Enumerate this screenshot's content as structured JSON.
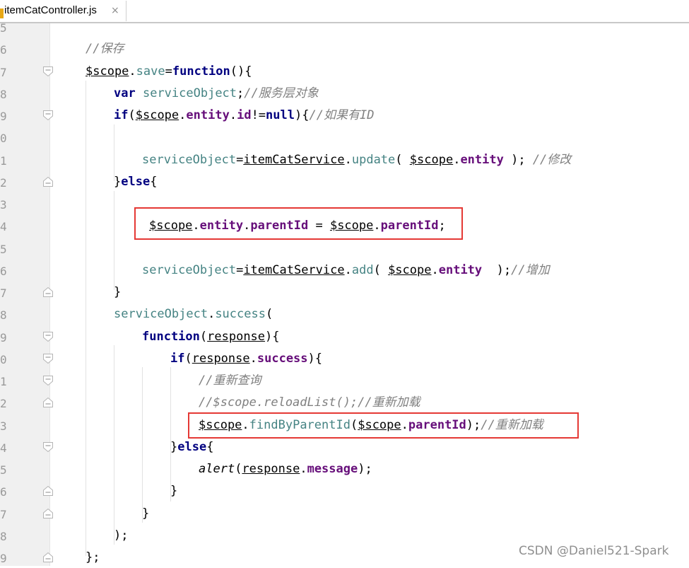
{
  "tab": {
    "label": "itemCatController.js",
    "close": "×"
  },
  "line_numbers": [
    "5",
    "6",
    "7",
    "8",
    "9",
    "0",
    "1",
    "2",
    "3",
    "4",
    "5",
    "6",
    "7",
    "8",
    "9",
    "0",
    "1",
    "2",
    "3",
    "4",
    "5",
    "6",
    "7",
    "8",
    "9"
  ],
  "code": [
    [],
    [
      [
        "cm",
        "//保存"
      ]
    ],
    [
      [
        "sc",
        "$scope"
      ],
      [
        "pu",
        "."
      ],
      [
        "var",
        "save"
      ],
      [
        "pu",
        "="
      ],
      [
        "kw",
        "function"
      ],
      [
        "pu",
        "(){"
      ]
    ],
    [
      [
        "kw",
        "var"
      ],
      [
        "pu",
        " "
      ],
      [
        "var",
        "serviceObject"
      ],
      [
        "pu",
        ";"
      ],
      [
        "cm",
        "//服务层对象"
      ]
    ],
    [
      [
        "kw",
        "if"
      ],
      [
        "pu",
        "("
      ],
      [
        "sc",
        "$scope"
      ],
      [
        "pu",
        "."
      ],
      [
        "pr",
        "entity"
      ],
      [
        "pu",
        "."
      ],
      [
        "pr",
        "id"
      ],
      [
        "pu",
        "!="
      ],
      [
        "kw",
        "null"
      ],
      [
        "pu",
        ")"
      ],
      [
        "pu",
        "{"
      ],
      [
        "cm",
        "//如果有ID"
      ]
    ],
    [],
    [
      [
        "var",
        "serviceObject"
      ],
      [
        "pu",
        "="
      ],
      [
        "sc",
        "itemCatService"
      ],
      [
        "pu",
        "."
      ],
      [
        "var",
        "update"
      ],
      [
        "pu",
        "( "
      ],
      [
        "sc",
        "$scope"
      ],
      [
        "pu",
        "."
      ],
      [
        "pr",
        "entity"
      ],
      [
        "pu",
        " ); "
      ],
      [
        "cm",
        "//修改"
      ]
    ],
    [
      [
        "pu",
        "}"
      ],
      [
        "kw",
        "else"
      ],
      [
        "pu",
        "{"
      ]
    ],
    [],
    [
      [
        "sc",
        "$scope"
      ],
      [
        "pu",
        "."
      ],
      [
        "pr",
        "entity"
      ],
      [
        "pu",
        "."
      ],
      [
        "pr",
        "parentId"
      ],
      [
        "pu",
        " = "
      ],
      [
        "sc",
        "$scope"
      ],
      [
        "pu",
        "."
      ],
      [
        "pr",
        "parentId"
      ],
      [
        "pu",
        ";"
      ]
    ],
    [],
    [
      [
        "var",
        "serviceObject"
      ],
      [
        "pu",
        "="
      ],
      [
        "sc",
        "itemCatService"
      ],
      [
        "pu",
        "."
      ],
      [
        "var",
        "add"
      ],
      [
        "pu",
        "( "
      ],
      [
        "sc",
        "$scope"
      ],
      [
        "pu",
        "."
      ],
      [
        "pr",
        "entity"
      ],
      [
        "pu",
        "  );"
      ],
      [
        "cm",
        "//增加"
      ]
    ],
    [
      [
        "pu",
        "}"
      ]
    ],
    [
      [
        "var",
        "serviceObject"
      ],
      [
        "pu",
        "."
      ],
      [
        "var",
        "success"
      ],
      [
        "pu",
        "("
      ]
    ],
    [
      [
        "kw",
        "function"
      ],
      [
        "pu",
        "("
      ],
      [
        "sc",
        "response"
      ],
      [
        "pu",
        "){"
      ]
    ],
    [
      [
        "kw",
        "if"
      ],
      [
        "pu",
        "("
      ],
      [
        "sc",
        "response"
      ],
      [
        "pu",
        "."
      ],
      [
        "pr",
        "success"
      ],
      [
        "pu",
        "){"
      ]
    ],
    [
      [
        "cm",
        "//重新查询"
      ]
    ],
    [
      [
        "cm",
        "//$scope.reloadList();//重新加载"
      ]
    ],
    [
      [
        "sc",
        "$scope"
      ],
      [
        "pu",
        "."
      ],
      [
        "var",
        "findByParentId"
      ],
      [
        "pu",
        "("
      ],
      [
        "sc",
        "$scope"
      ],
      [
        "pu",
        "."
      ],
      [
        "pr",
        "parentId"
      ],
      [
        "pu",
        ");"
      ],
      [
        "cm",
        "//重新加载"
      ]
    ],
    [
      [
        "pu",
        "}"
      ],
      [
        "kw",
        "else"
      ],
      [
        "pu",
        "{"
      ]
    ],
    [
      [
        "gl",
        "alert"
      ],
      [
        "pu",
        "("
      ],
      [
        "sc",
        "response"
      ],
      [
        "pu",
        "."
      ],
      [
        "pr",
        "message"
      ],
      [
        "pu",
        ");"
      ]
    ],
    [
      [
        "pu",
        "}"
      ]
    ],
    [
      [
        "pu",
        "}"
      ]
    ],
    [
      [
        "pu",
        ");"
      ]
    ],
    [
      [
        "pu",
        "};"
      ]
    ]
  ],
  "folds": [
    "none",
    "none",
    "open",
    "none",
    "open",
    "none",
    "none",
    "close",
    "none",
    "none",
    "none",
    "none",
    "close",
    "none",
    "open",
    "open",
    "open",
    "close",
    "none",
    "open",
    "none",
    "close",
    "close",
    "none",
    "close"
  ],
  "watermark": "CSDN @Daniel521-Spark",
  "colors": {
    "keyword": "#000080",
    "comment": "#808080",
    "variable": "#458383",
    "property": "#660e7a",
    "highlight_box": "#e53935",
    "gutter_bg": "#f0f0f0"
  }
}
